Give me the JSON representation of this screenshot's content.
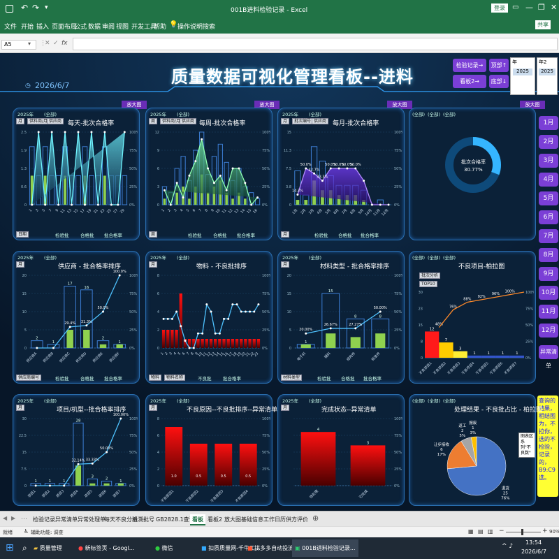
{
  "window": {
    "title": "001B进料检验记录  -  Excel",
    "login": "登录"
  },
  "ribbon": {
    "tabs": [
      "文件",
      "开始",
      "插入",
      "页面布局",
      "公式",
      "数据",
      "审阅",
      "视图",
      "开发工具",
      "帮助"
    ],
    "tell_me": "操作说明搜索",
    "share": "共享"
  },
  "formula": {
    "cell_ref": "A5"
  },
  "dashboard": {
    "title": "质量数据可视化管理看板--进料",
    "date": "2026/6/7",
    "nav": {
      "inspection_log": "检验记录→",
      "top": "顶部↑",
      "board2": "看板2→",
      "bottom": "底部↓"
    },
    "year_header": "年",
    "year_header2": "年2",
    "year_value": "2025",
    "months": [
      "1月",
      "2月",
      "3月",
      "4月",
      "5月",
      "6月",
      "7月",
      "8月",
      "9月",
      "10月",
      "11月",
      "12月",
      "异常清单"
    ],
    "zoom_label": "放大图",
    "side_note": "查询的结果，相结图为，不拉你，选的不检验，记录的，B9:C9选。",
    "tooltip": [
      "图表区",
      "系列\"不良数\""
    ]
  },
  "panels": [
    {
      "title": "每天-批次合格率",
      "filters": [
        "2025年",
        "(全部)",
        "(全部)",
        "月",
        "供料商/月",
        "供应商"
      ],
      "footer": "日期",
      "legend": [
        "检验批",
        "合格批",
        "批合格率"
      ]
    },
    {
      "title": "每周-批次合格率",
      "filters": [
        "2025年",
        "(全部)",
        "(全部)",
        "周",
        "供料商/月",
        "供应商"
      ],
      "footer": "周",
      "legend": [
        "检验批",
        "合格批",
        "批合格率"
      ]
    },
    {
      "title": "每月-批次合格率",
      "filters": [
        "2025年",
        "(全部)",
        "(全部)",
        "月",
        "批次编号",
        "供应商"
      ],
      "footer": "月",
      "legend": [
        "检验批",
        "合格批",
        "批合格率"
      ]
    },
    {
      "title": "",
      "filters": [
        "(全部)",
        "(全部)",
        "(全部)"
      ],
      "donut_label": "批次合格率",
      "donut_value": "30.77%"
    },
    {
      "title": "供应商 - 批合格率排序",
      "filters": [
        "2025年",
        "(全部)",
        "(全部)",
        "月"
      ],
      "footer": "供应商编号",
      "legend": [
        "检验批",
        "合格批",
        "批合格率"
      ]
    },
    {
      "title": "物料 - 不良批排序",
      "filters": [
        "2025年",
        "(全部)",
        "(全部)",
        "月"
      ],
      "footer": [
        "物料",
        "物料名称"
      ],
      "legend": [
        "不良批",
        "批合格率"
      ]
    },
    {
      "title": "材料类型 - 批合格率排序",
      "filters": [
        "2025年",
        "(全部)",
        "(全部)",
        "月"
      ],
      "footer": "材料类型",
      "legend": [
        "检验批",
        "合格批",
        "批合格率"
      ]
    },
    {
      "title": "不良项目-柏拉图",
      "filters": [
        "(全部)",
        "(全部)",
        "(全部)",
        "批次分析",
        "TOP10"
      ]
    },
    {
      "title": "项目/机型--批合格率排序",
      "filters": [
        "2025年",
        "(全部)",
        "(全部)",
        "月"
      ]
    },
    {
      "title": "不良原因--不良批排序--异常清单",
      "filters": [
        "2025年",
        "(全部)",
        "(全部)",
        "月"
      ]
    },
    {
      "title": "完成状态--异常清单",
      "filters": [
        "2025年",
        "(全部)",
        "(全部)",
        "月"
      ]
    },
    {
      "title": "处理结果 - 不良批占比 - 柏拉图",
      "filters": [
        "(全部)",
        "(全部)",
        "(全部)"
      ]
    }
  ],
  "chart_data": [
    {
      "type": "bar",
      "title": "每天-批次合格率",
      "x_label": "日期",
      "series": [
        {
          "name": "检验批"
        },
        {
          "name": "合格批"
        },
        {
          "name": "批合格率"
        }
      ],
      "x": [
        "1",
        "3",
        "5",
        "7",
        "9",
        "11",
        "13",
        "15",
        "17",
        "19",
        "21",
        "23",
        "25",
        "27",
        "29"
      ],
      "ylim": [
        0,
        2.5
      ],
      "y2lim": [
        0,
        1
      ],
      "values_inspect": [
        2,
        1,
        2,
        1,
        1,
        2,
        1,
        1,
        2,
        1,
        1,
        2,
        1,
        1,
        1
      ],
      "values_pass": [
        1,
        0,
        1,
        0,
        0,
        1,
        0,
        0,
        1,
        0,
        0,
        1,
        0,
        0,
        0
      ],
      "values_rate": [
        0,
        1,
        0,
        1,
        0,
        1,
        0,
        1,
        0,
        1,
        0,
        1,
        0,
        0,
        1
      ]
    },
    {
      "type": "bar",
      "title": "每周-批次合格率",
      "x_label": "周",
      "x": [
        "1",
        "2",
        "3",
        "4",
        "5",
        "6",
        "7",
        "8",
        "9",
        "10",
        "11",
        "12",
        "13",
        "14",
        "15",
        "16"
      ],
      "ylim": [
        0,
        12
      ],
      "y2lim": [
        0,
        1
      ],
      "values_inspect": [
        3,
        2,
        6,
        8,
        4,
        9,
        12,
        5,
        8,
        10,
        7,
        4,
        6,
        3,
        2,
        1
      ],
      "values_pass": [
        1,
        0,
        2,
        3,
        1,
        3,
        5,
        2,
        3,
        4,
        2,
        1,
        2,
        1,
        0,
        0
      ],
      "values_rate": [
        0.2,
        0,
        0.3,
        0.1,
        0.4,
        0.6,
        0.9,
        0.5,
        0.3,
        0.4,
        0.2,
        0.5,
        0.5,
        0.3,
        0,
        0.1
      ]
    },
    {
      "type": "bar",
      "title": "每月-批次合格率",
      "x_label": "月",
      "x": [
        "1月",
        "2月",
        "3月",
        "4月",
        "5月",
        "6月",
        "7月",
        "8月",
        "9月",
        "10月",
        "11月",
        "12月"
      ],
      "ylim": [
        0,
        15
      ],
      "y2lim": [
        0,
        1
      ],
      "rate_labels": [
        "14.3%",
        "50.0%",
        "42.7%",
        "33.3%",
        "50.0%",
        "50.0%",
        "50.0%",
        "50.0%"
      ],
      "values_inspect": [
        7,
        2,
        12,
        9,
        6,
        4,
        4,
        4,
        3,
        0,
        1,
        0
      ],
      "values_pass": [
        1,
        1,
        5,
        3,
        3,
        2,
        2,
        2,
        1,
        0,
        0,
        0
      ],
      "values_rate": [
        0.14,
        0.5,
        0.43,
        0.33,
        0.5,
        0.5,
        0.5,
        0.5,
        0.33,
        0,
        0,
        0
      ]
    },
    {
      "type": "pie",
      "title": "批次合格率",
      "value": 30.77
    },
    {
      "type": "bar",
      "title": "供应商 - 批合格率排序",
      "categories": [
        "供应商A",
        "供应商B",
        "供应商C",
        "供应商D",
        "供应商E",
        "供应商F"
      ],
      "values_inspect": [
        2,
        1,
        17,
        16,
        2,
        1
      ],
      "values_pass": [
        0,
        0,
        5,
        5,
        1,
        1
      ],
      "rate_labels": [
        "29.4%",
        "31.3%",
        "50.0%",
        "100.0%"
      ],
      "values_rate": [
        0,
        0,
        0.29,
        0.31,
        0.5,
        1
      ]
    },
    {
      "type": "bar",
      "title": "物料 - 不良批排序",
      "ylim": [
        0,
        8
      ],
      "values": [
        2,
        2,
        2,
        2,
        6,
        1,
        1,
        1,
        1,
        1,
        1,
        1,
        1,
        1,
        1,
        1,
        1,
        1,
        1,
        1,
        1,
        1,
        1
      ],
      "values_rate": [
        0.4,
        0.4,
        0.4,
        0.5,
        0.3,
        0.1,
        0,
        0,
        0.2,
        0.2,
        0.6,
        0.5,
        0.2,
        0.2,
        0.4,
        0.4,
        0.6,
        0.6,
        0.5,
        0.5,
        0.5,
        0.5,
        0.6
      ]
    },
    {
      "type": "bar",
      "title": "材料类型 - 批合格率排序",
      "categories": [
        "电子料",
        "辅料",
        "结构件",
        "标准件"
      ],
      "values_inspect": [
        1,
        15,
        8,
        8
      ],
      "values_pass": [
        1,
        4,
        3,
        4
      ],
      "rate_labels": [
        "20.00%",
        "26.67%",
        "27.27%",
        "50.00%"
      ],
      "values_rate": [
        0.2,
        0.27,
        0.27,
        0.5
      ]
    },
    {
      "type": "bar",
      "title": "不良项目-柏拉图",
      "categories": [
        "不良项目1",
        "不良项目2",
        "不良项目3",
        "不良项目4",
        "不良项目5",
        "不良项目6",
        "不良项目7"
      ],
      "values": [
        12,
        7,
        3,
        1,
        1,
        1,
        1
      ],
      "cumulative_labels": [
        "48%",
        "76%",
        "88%",
        "92%",
        "96%",
        "100%"
      ],
      "ylim": [
        0,
        30
      ]
    },
    {
      "type": "bar",
      "title": "项目/机型--批合格率排序",
      "categories": [
        "项目1",
        "项目2",
        "项目3",
        "项目4",
        "项目5",
        "项目6",
        "项目7"
      ],
      "values_inspect": [
        1,
        1,
        1,
        28,
        3,
        2,
        1
      ],
      "values_pass": [
        0,
        0,
        0,
        9,
        1,
        1,
        1
      ],
      "rate_labels": [
        "32.14%",
        "33.33%",
        "50.00%",
        "100.00%"
      ],
      "values_rate": [
        0,
        0,
        0,
        0.32,
        0.33,
        0.5,
        1
      ]
    },
    {
      "type": "bar",
      "title": "不良原因--不良批排序--异常清单",
      "categories": [
        "不良原因1",
        "不良原因2",
        "不良原因3",
        "不良原因4"
      ],
      "values": [
        7,
        5,
        5,
        5
      ],
      "rate_labels": [
        "1.0",
        "0.5",
        "0.5",
        "0.5"
      ],
      "ylim": [
        0,
        8
      ]
    },
    {
      "type": "bar",
      "title": "完成状态--异常清单",
      "categories": [
        "待处理",
        "已完成"
      ],
      "values": [
        4,
        3
      ],
      "ylim": [
        0,
        5
      ]
    },
    {
      "type": "pie",
      "title": "处理结果 - 不良批占比 - 柏拉图",
      "slices": [
        {
          "label": "退货",
          "value": 25,
          "pct": "76%"
        },
        {
          "label": "让步接收",
          "value": 6,
          "pct": "17%"
        },
        {
          "label": "返工",
          "value": 2,
          "pct": "5%"
        },
        {
          "label": "报废",
          "value": 1,
          "pct": "3%"
        }
      ]
    }
  ],
  "sheet_tabs": [
    "检验记录",
    "异常清单",
    "异常处理单",
    "每天不良分析",
    "追溯批号",
    "GB2828.1查询表",
    "看板",
    "看板2",
    "放大图",
    "基础信息",
    "工作日历",
    "供方评价"
  ],
  "status": {
    "ready": "就绪",
    "access": "辅助功能: 调查",
    "zoom": "90%"
  },
  "taskbar": {
    "items": [
      "质量管理",
      "新标签页 - Googl...",
      "微信",
      "扣质质量网-千牛工...",
      "拼多多自动投流...",
      "001B进料检验记录..."
    ],
    "time": "13:54",
    "date": "2026/6/7"
  }
}
